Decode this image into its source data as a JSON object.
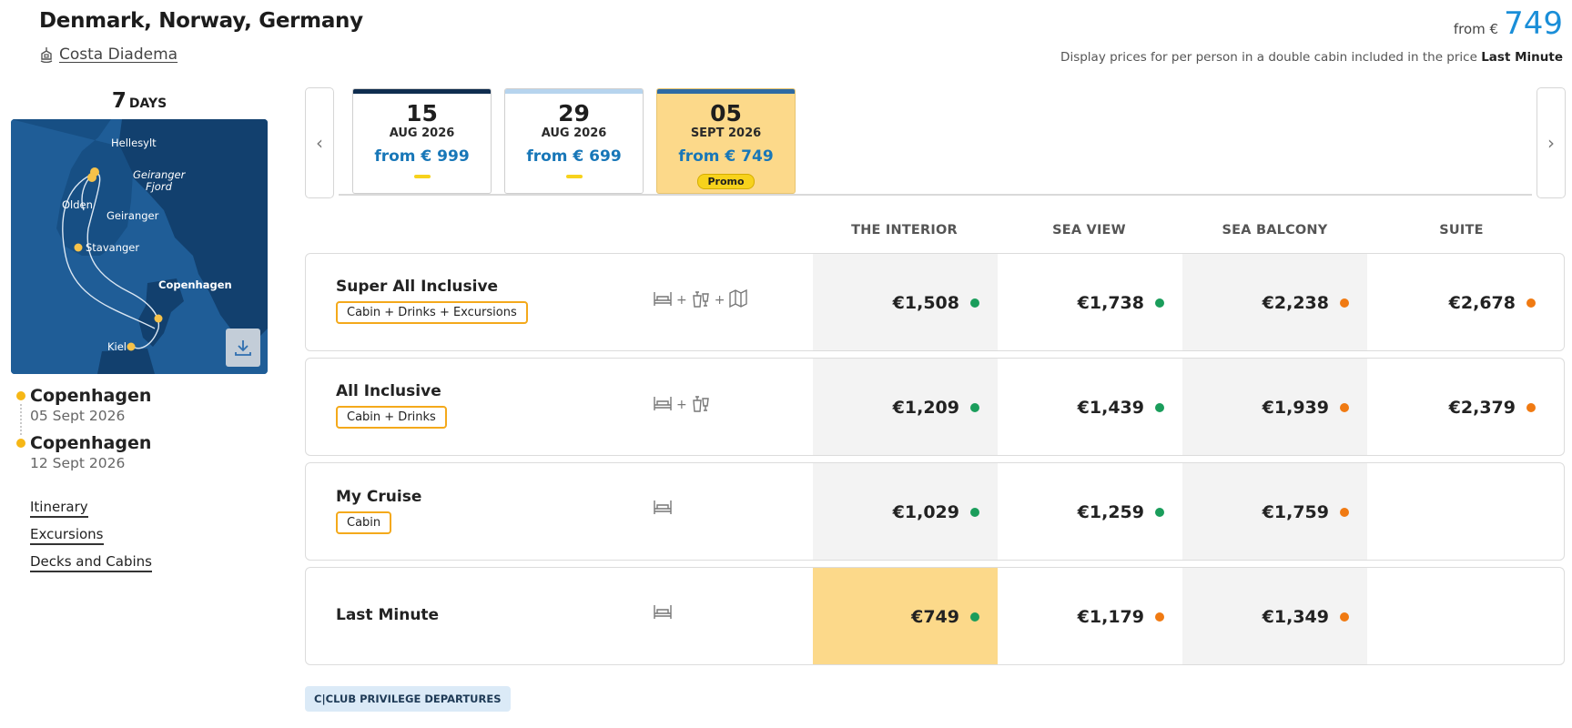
{
  "header": {
    "title": "Denmark, Norway, Germany",
    "ship": "Costa Diadema",
    "price_from_label": "from €",
    "price_from_value": "749",
    "disclaimer_text": "Display prices for per person in a double cabin included in the price",
    "disclaimer_bold": "Last Minute"
  },
  "trip": {
    "days_num": "7",
    "days_word": "DAYS",
    "map_labels": [
      "Hellesylt",
      "Geiranger",
      "Fjord",
      "Olden",
      "Geiranger",
      "Stavanger",
      "Copenhagen",
      "Kiel"
    ],
    "stops": [
      {
        "city": "Copenhagen",
        "date": "05 Sept 2026"
      },
      {
        "city": "Copenhagen",
        "date": "12 Sept 2026"
      }
    ]
  },
  "links": [
    "Itinerary",
    "Excursions",
    "Decks and Cabins"
  ],
  "dates": [
    {
      "day": "15",
      "month": "AUG 2026",
      "price": "from € 999"
    },
    {
      "day": "29",
      "month": "AUG 2026",
      "price": "from € 699"
    },
    {
      "day": "05",
      "month": "SEPT 2026",
      "price": "from € 749",
      "promo": "Promo"
    }
  ],
  "nav": {
    "prev": "‹",
    "next": "›"
  },
  "columns": [
    "THE INTERIOR",
    "SEA VIEW",
    "SEA BALCONY",
    "SUITE"
  ],
  "packages": [
    {
      "name": "Super All Inclusive",
      "tag": "Cabin + Drinks + Excursions",
      "prices": [
        "€1,508",
        "€1,738",
        "€2,238",
        "€2,678"
      ],
      "status": [
        "green",
        "green",
        "orange",
        "orange"
      ]
    },
    {
      "name": "All Inclusive",
      "tag": "Cabin + Drinks",
      "prices": [
        "€1,209",
        "€1,439",
        "€1,939",
        "€2,379"
      ],
      "status": [
        "green",
        "green",
        "orange",
        "orange"
      ]
    },
    {
      "name": "My Cruise",
      "tag": "Cabin",
      "prices": [
        "€1,029",
        "€1,259",
        "€1,759",
        ""
      ],
      "status": [
        "green",
        "green",
        "orange",
        ""
      ]
    },
    {
      "name": "Last Minute",
      "tag": "",
      "prices": [
        "€749",
        "€1,179",
        "€1,349",
        ""
      ],
      "status": [
        "green",
        "orange",
        "orange",
        ""
      ]
    }
  ],
  "club_badge": "C|CLUB PRIVILEGE DEPARTURES",
  "colors": {
    "accent": "#1a8ed8",
    "green": "#1a9d5b",
    "orange": "#f07a12",
    "highlight": "#fcd98a",
    "tag_border": "#f4a91b"
  }
}
